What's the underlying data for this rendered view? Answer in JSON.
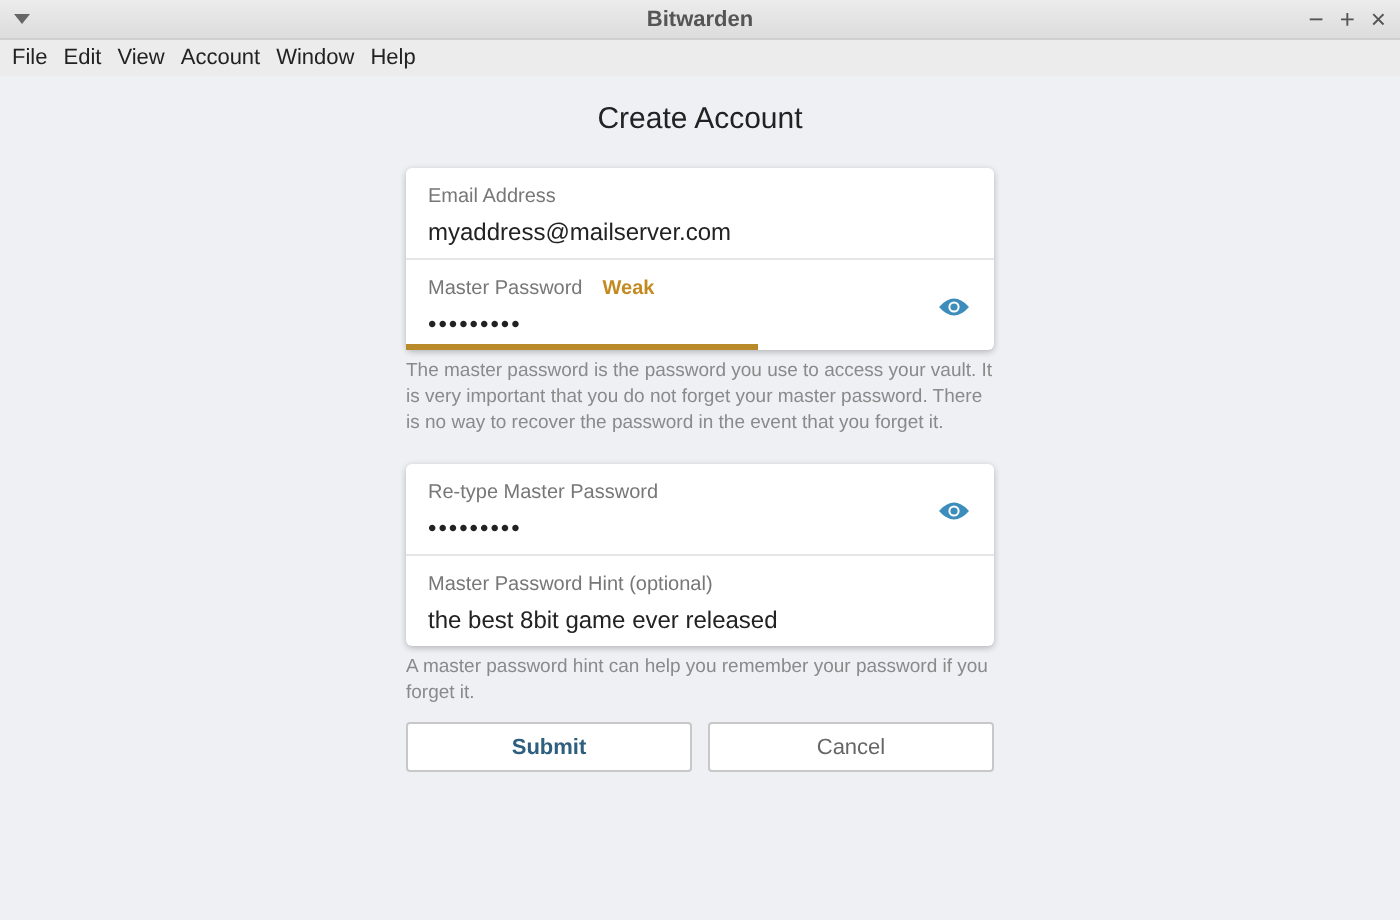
{
  "window": {
    "title": "Bitwarden",
    "controls": [
      "−",
      "+",
      "×"
    ]
  },
  "menu": [
    "File",
    "Edit",
    "View",
    "Account",
    "Window",
    "Help"
  ],
  "heading": "Create Account",
  "groups": [
    {
      "fields": [
        {
          "kind": "text",
          "label": "Email Address",
          "value": "myaddress@mailserver.com"
        },
        {
          "kind": "password",
          "label": "Master Password",
          "strength": "Weak",
          "level": 0.6,
          "value": "•••••••••"
        }
      ],
      "help": "The master password is the password you use to access your vault. It is very important that you do not forget your master password. There is no way to recover the password in the event that you forget it."
    },
    {
      "fields": [
        {
          "kind": "password",
          "label": "Re-type Master Password",
          "value": "•••••••••"
        },
        {
          "kind": "text",
          "label": "Master Password Hint (optional)",
          "value": "the best 8bit game ever released"
        }
      ],
      "help": "A master password hint can help you remember your password if you forget it."
    }
  ],
  "buttons": [
    {
      "kind": "primary",
      "label": "Submit"
    },
    {
      "kind": "secondary",
      "label": "Cancel"
    }
  ]
}
